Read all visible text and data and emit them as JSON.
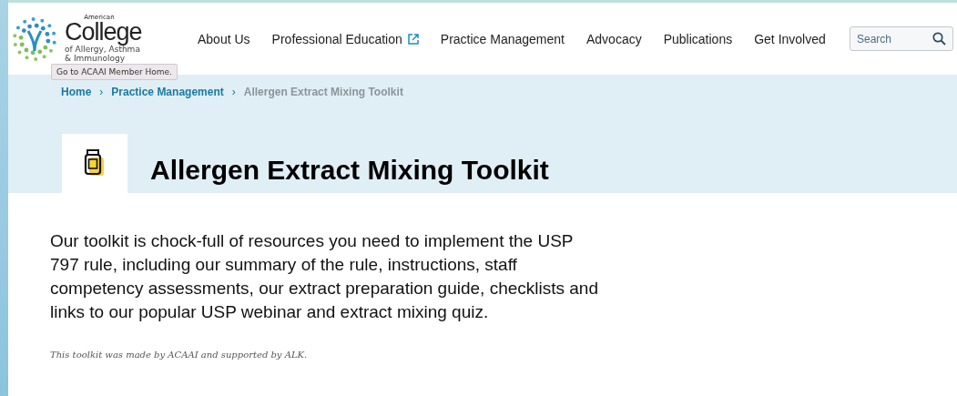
{
  "logo": {
    "small": "American",
    "big": "College",
    "sub_1": "of Allergy, Asthma",
    "sub_2": "& Immunology"
  },
  "tooltip": "Go to ACAAI Member Home.",
  "nav": [
    {
      "label": "About Us",
      "external": false
    },
    {
      "label": "Professional Education",
      "external": true
    },
    {
      "label": "Practice Management",
      "external": false
    },
    {
      "label": "Advocacy",
      "external": false
    },
    {
      "label": "Publications",
      "external": false
    },
    {
      "label": "Get Involved",
      "external": false
    }
  ],
  "search": {
    "placeholder": "Search"
  },
  "breadcrumb": [
    {
      "label": "Home",
      "current": false
    },
    {
      "label": "Practice Management",
      "current": false
    },
    {
      "label": "Allergen Extract Mixing Toolkit",
      "current": true
    }
  ],
  "breadcrumb_separator": "›",
  "title": "Allergen Extract Mixing Toolkit",
  "intro": "Our toolkit is chock-full of resources you need to implement the USP 797 rule, including our summary of the rule, instructions, staff competency assessments, our extract preparation guide, checklists and links to our popular USP webinar and extract mixing quiz.",
  "credit": "This toolkit was made by ACAAI and supported by ALK."
}
